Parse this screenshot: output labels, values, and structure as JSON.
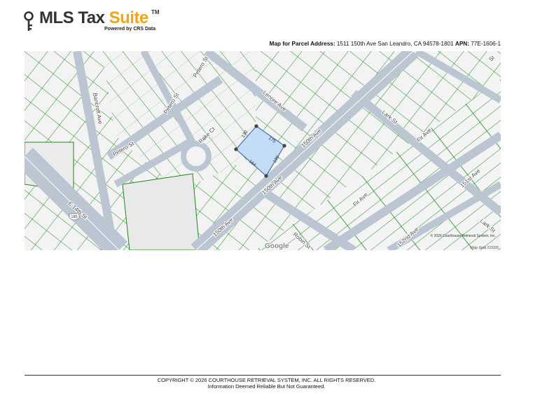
{
  "logo": {
    "part1": "MLS Tax ",
    "part2": "Suite",
    "tm": "TM",
    "powered_by": "Powered by CRS Data"
  },
  "map_header": {
    "label": "Map for Parcel Address:",
    "address": "1511 150th Ave San Leandro, CA 94578-1801",
    "apn_label": "APN:",
    "apn": "77E-1606-1"
  },
  "map": {
    "parcel_dimensions": [
      "130",
      "175",
      "130",
      "164"
    ],
    "streets": {
      "e14th": "E 14th St",
      "bancroft": "Bancroft Ave",
      "petero1": "Petero St",
      "petero2": "Petero St",
      "petero3": "Petero St",
      "lenore": "Lenore Ave",
      "rake": "Rake Ct",
      "ave150_top": "150th Ave",
      "ave150_mid": "150th Ave",
      "ave150_bot": "150th Ave",
      "lark1": "Lark St",
      "lark2": "Lark St",
      "fir1": "Fir Ave",
      "fir2": "Fir Ave",
      "ave151": "151st Ave",
      "ave152": "152nd Ave",
      "robin": "Robin St",
      "st_ne": "St"
    },
    "highway_shield": "185",
    "attribution": "© 2026 Courthouse Retrieval System, Inc.",
    "google": "Google",
    "map_data": "Map data ©2026",
    "colors": {
      "parcel_line": "#1a8a1a",
      "road": "#bcc6d3",
      "highlight_fill": "#c4dcf7",
      "highlight_stroke": "#4a6fa8",
      "vertex": "#444444",
      "accent": "#f2a516"
    }
  },
  "footer": {
    "copyright": "COPYRIGHT © 2026 COURTHOUSE RETRIEVAL SYSTEM, INC. ALL RIGHTS RESERVED.",
    "disclaimer": "Information Deemed Reliable But Not Guaranteed."
  }
}
